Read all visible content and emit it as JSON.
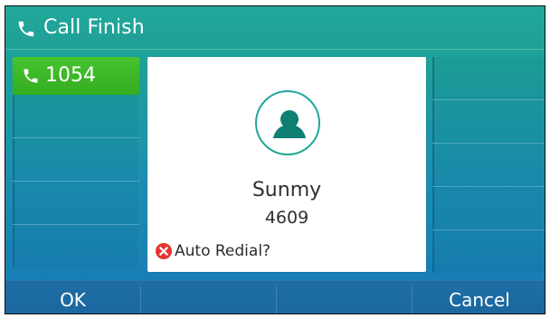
{
  "title_bar": {
    "title": "Call Finish",
    "icon": "phone-handset-icon"
  },
  "line_keys": {
    "active": {
      "label": "1054",
      "icon": "phone-handset-icon",
      "color": "#38B024"
    }
  },
  "call_card": {
    "avatar_icon": "user-avatar-icon",
    "contact_name": "Sunmy",
    "contact_number": "4609",
    "status_icon": "red-x-icon",
    "status_text": "Auto Redial?"
  },
  "softkeys": [
    {
      "label": "OK"
    },
    {
      "label": ""
    },
    {
      "label": ""
    },
    {
      "label": "Cancel"
    }
  ],
  "colors": {
    "screen_top": "#1DA397",
    "screen_bottom": "#1779B7",
    "accent": "#1DA898",
    "card_bg": "#FFFFFF",
    "alert_red": "#E74C3C"
  }
}
